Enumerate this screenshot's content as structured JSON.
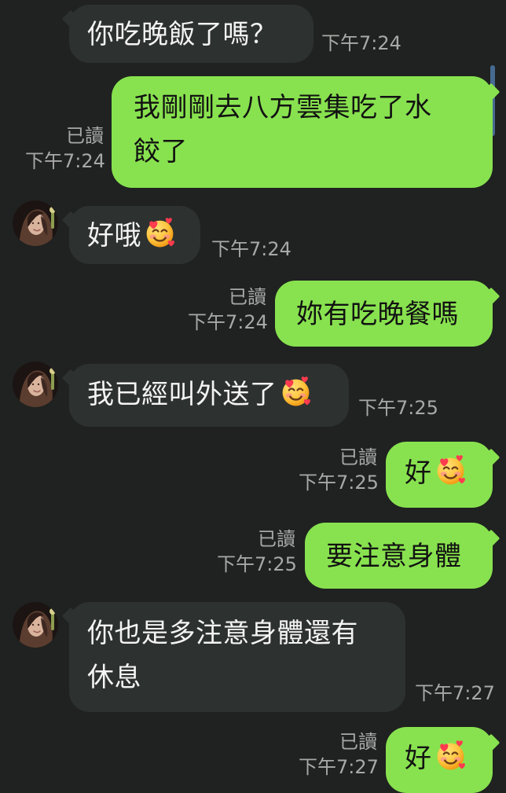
{
  "chat": {
    "messages": [
      {
        "direction": "incoming",
        "text": "你吃晚飯了嗎？",
        "time": "下午7:24"
      },
      {
        "direction": "outgoing",
        "line1": "我剛剛去八方雲集吃了水",
        "line2": "餃了",
        "read": "已讀",
        "time": "下午7:24"
      },
      {
        "direction": "incoming",
        "text": "好哦",
        "emoji": "smiling-face-with-hearts-icon",
        "time": "下午7:24"
      },
      {
        "direction": "outgoing",
        "text": "妳有吃晚餐嗎",
        "read": "已讀",
        "time": "下午7:24"
      },
      {
        "direction": "incoming",
        "text": "我已經叫外送了",
        "emoji": "smiling-face-with-hearts-icon",
        "time": "下午7:25"
      },
      {
        "direction": "outgoing",
        "text": "好",
        "emoji": "smiling-face-with-hearts-icon",
        "read": "已讀",
        "time": "下午7:25"
      },
      {
        "direction": "outgoing",
        "text": "要注意身體",
        "read": "已讀",
        "time": "下午7:25"
      },
      {
        "direction": "incoming",
        "line1": "你也是多注意身體還有",
        "line2": "休息",
        "time": "下午7:27"
      },
      {
        "direction": "outgoing",
        "text": "好",
        "emoji": "smiling-face-with-hearts-icon",
        "read": "已讀",
        "time": "下午7:27"
      }
    ]
  },
  "colors": {
    "background": "#1f2220",
    "incoming_bubble": "#2d3130",
    "outgoing_bubble": "#88e24f",
    "timestamp": "#a8a8a8",
    "scrollbar": "#4a6f9a"
  }
}
